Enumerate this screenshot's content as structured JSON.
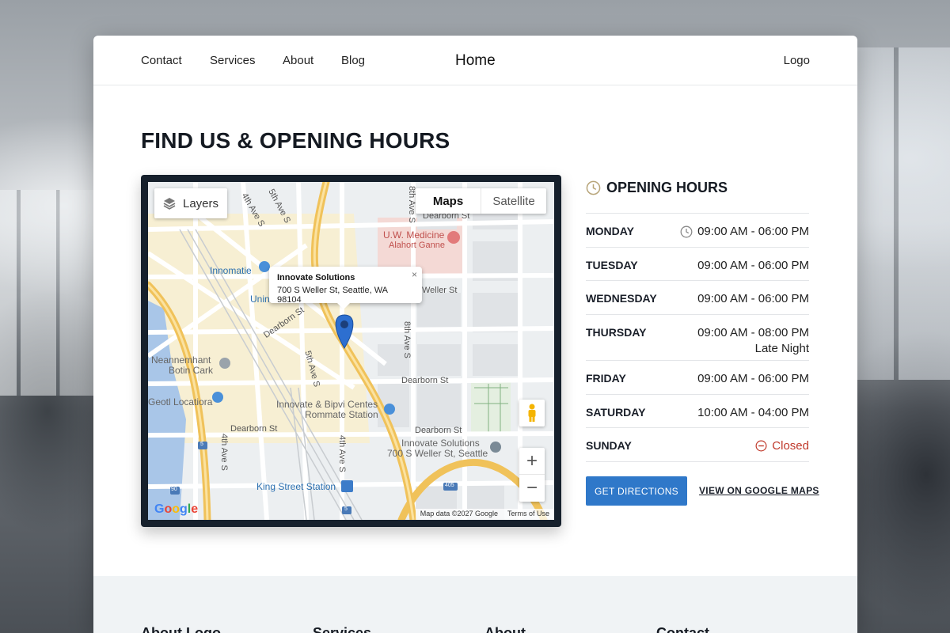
{
  "nav": {
    "items": [
      "Contact",
      "Services",
      "About",
      "Blog"
    ],
    "home": "Home",
    "logo": "Logo"
  },
  "page": {
    "title": "FIND US & OPENING HOURS"
  },
  "map": {
    "layers_label": "Layers",
    "type_maps": "Maps",
    "type_satellite": "Satellite",
    "info_title": "Innovate Solutions",
    "info_address": "700 S Weller St, Seattle, WA 98104",
    "info_close": "×",
    "zoom_in": "+",
    "zoom_out": "−",
    "google": "Google",
    "map_data": "Map data ©2027 Google",
    "terms": "Terms of Use",
    "labels": {
      "ave4_top": "4th Ave S",
      "ave5_top": "5th Ave S",
      "ave8_top": "8th Ave S",
      "dearborn_top": "Dearborn St",
      "uw_medicine": "U.W. Medicine",
      "alahort": "Alahort Ganne",
      "innomatie": "Innomatie",
      "unin": "Unin",
      "weller_st": "Weller St",
      "dearborn_diag": "Dearborn St",
      "ave4_mid": "4th Ave S",
      "ave8_mid": "8th Ave S",
      "dearborn_mid": "Dearborn St",
      "neannemhant": "Neannemhant",
      "botin_cark": "Botin Cark",
      "ave5_mid": "5th Ave S",
      "geotl": "Geotl Locatiora",
      "bipvi": "Innovate & Bipvi Centes",
      "rommate": "Rommate Station",
      "dearborn_low": "Dearborn St",
      "ave4_low": "4th Ave S",
      "dearborn_low2": "Dearborn St",
      "ave4_low2": "4th Ave S",
      "is_name": "Innovate Solutions",
      "is_addr": "700 S Weller St, Seattle",
      "king_street": "King Street Station",
      "shield_5": "5",
      "shield_90": "90",
      "shield_5b": "5",
      "shield_405": "405"
    }
  },
  "hours": {
    "title": "OPENING HOURS",
    "rows": [
      {
        "day": "MONDAY",
        "time": "09:00 AM - 06:00 PM",
        "note": ""
      },
      {
        "day": "TUESDAY",
        "time": "09:00 AM - 06:00 PM",
        "note": ""
      },
      {
        "day": "WEDNESDAY",
        "time": "09:00 AM - 06:00 PM",
        "note": ""
      },
      {
        "day": "THURSDAY",
        "time": "09:00 AM - 08:00 PM",
        "note": "Late Night"
      },
      {
        "day": "FRIDAY",
        "time": "09:00 AM - 06:00 PM",
        "note": ""
      },
      {
        "day": "SATURDAY",
        "time": "10:00 AM - 04:00 PM",
        "note": ""
      },
      {
        "day": "SUNDAY",
        "time": "Closed",
        "note": ""
      }
    ],
    "directions": "GET DIRECTIONS",
    "google_link": "VIEW ON GOOGLE MAPS"
  },
  "footer": {
    "cols": [
      "About Logo",
      "Services",
      "About",
      "Contact"
    ]
  },
  "colors": {
    "accent": "#2f78c9",
    "closed": "#c0392b",
    "map_frame": "#16202c",
    "road_major": "#f5c96a",
    "clock_icon": "#b8a57a"
  }
}
